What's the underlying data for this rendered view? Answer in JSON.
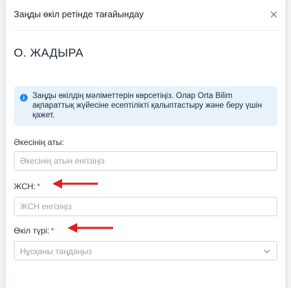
{
  "modal": {
    "title": "Заңды өкіл ретінде тағайындау",
    "person_name": "О. ЖАДЫРА"
  },
  "info": {
    "text": "Заңды өкілдің мәліметтерін көрсетіңіз. Олар Orta Bilim ақпараттық жүйесіне есептілікті қалыптастыру және беру үшін қажет."
  },
  "form": {
    "father_name": {
      "label": "Әкесінің аты:",
      "placeholder": "Әкесінің атын енгізіңіз",
      "value": ""
    },
    "iin": {
      "label": "ЖСН:",
      "required_mark": "*",
      "placeholder": "ЖСН енгізіңіз",
      "value": ""
    },
    "representative_type": {
      "label": "Өкіл түрі:",
      "required_mark": "*",
      "selected": "Нұсқаны таңдаңыз"
    }
  },
  "colors": {
    "accent": "#1e88e5",
    "required": "#e53935",
    "annotation_arrow": "#e02020",
    "info_bg": "#e7f2fb"
  },
  "icons": {
    "close": "close-icon",
    "info": "info-icon",
    "dropdown": "chevron-down-icon"
  }
}
